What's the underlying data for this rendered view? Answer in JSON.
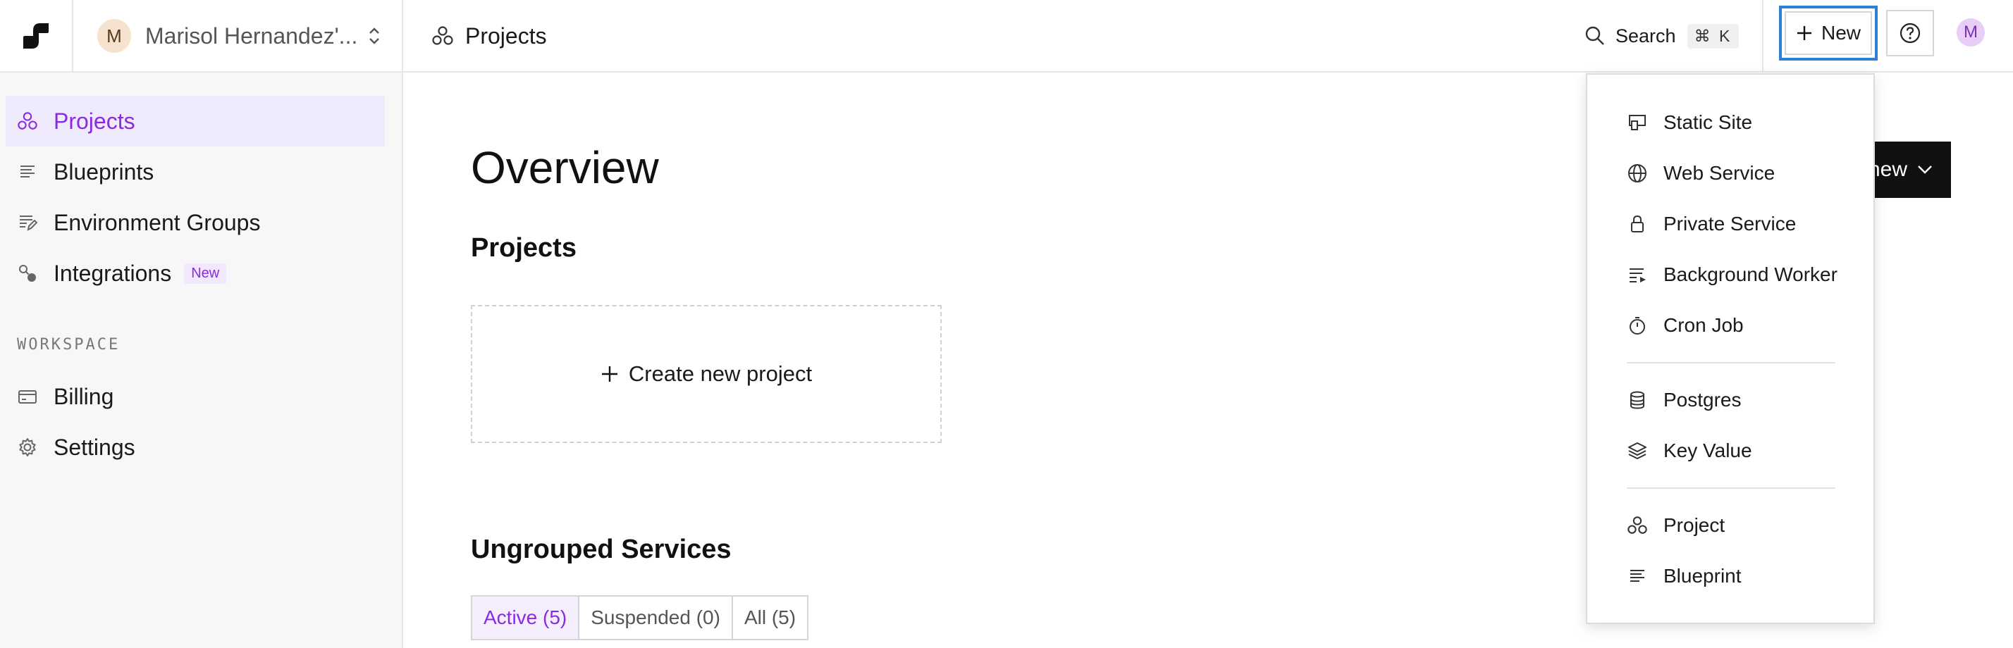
{
  "topbar": {
    "workspace": {
      "avatar_letter": "M",
      "name": "Marisol Hernandez'..."
    },
    "breadcrumb": {
      "label": "Projects"
    },
    "search": {
      "label": "Search",
      "shortcut": "⌘ K"
    },
    "new_button": {
      "label": "New"
    },
    "user_avatar_letter": "M"
  },
  "sidebar": {
    "items": [
      {
        "label": "Projects",
        "icon": "projects-icon",
        "active": true
      },
      {
        "label": "Blueprints",
        "icon": "blueprints-icon"
      },
      {
        "label": "Environment Groups",
        "icon": "environment-groups-icon"
      },
      {
        "label": "Integrations",
        "icon": "integrations-icon",
        "badge": "New"
      }
    ],
    "workspace_section": {
      "title": "WORKSPACE",
      "items": [
        {
          "label": "Billing",
          "icon": "billing-icon"
        },
        {
          "label": "Settings",
          "icon": "gear-icon"
        }
      ]
    }
  },
  "main": {
    "title": "Overview",
    "projects_heading": "Projects",
    "create_project_label": "Create new project",
    "ungrouped_heading": "Ungrouped Services",
    "filters": [
      {
        "label": "Active (5)",
        "active": true
      },
      {
        "label": "Suspended (0)"
      },
      {
        "label": "All (5)"
      }
    ],
    "partial_new_button": "new"
  },
  "dropdown": {
    "groups": [
      [
        {
          "label": "Static Site",
          "icon": "static-site-icon"
        },
        {
          "label": "Web Service",
          "icon": "globe-icon"
        },
        {
          "label": "Private Service",
          "icon": "lock-icon"
        },
        {
          "label": "Background Worker",
          "icon": "background-worker-icon"
        },
        {
          "label": "Cron Job",
          "icon": "stopwatch-icon"
        }
      ],
      [
        {
          "label": "Postgres",
          "icon": "database-icon"
        },
        {
          "label": "Key Value",
          "icon": "layers-icon"
        }
      ],
      [
        {
          "label": "Project",
          "icon": "projects-icon"
        },
        {
          "label": "Blueprint",
          "icon": "blueprints-icon"
        }
      ]
    ]
  },
  "colors": {
    "accent": "#8a2be2",
    "focus_ring": "#2f7fd6",
    "active_bg": "#f0ebfc"
  }
}
